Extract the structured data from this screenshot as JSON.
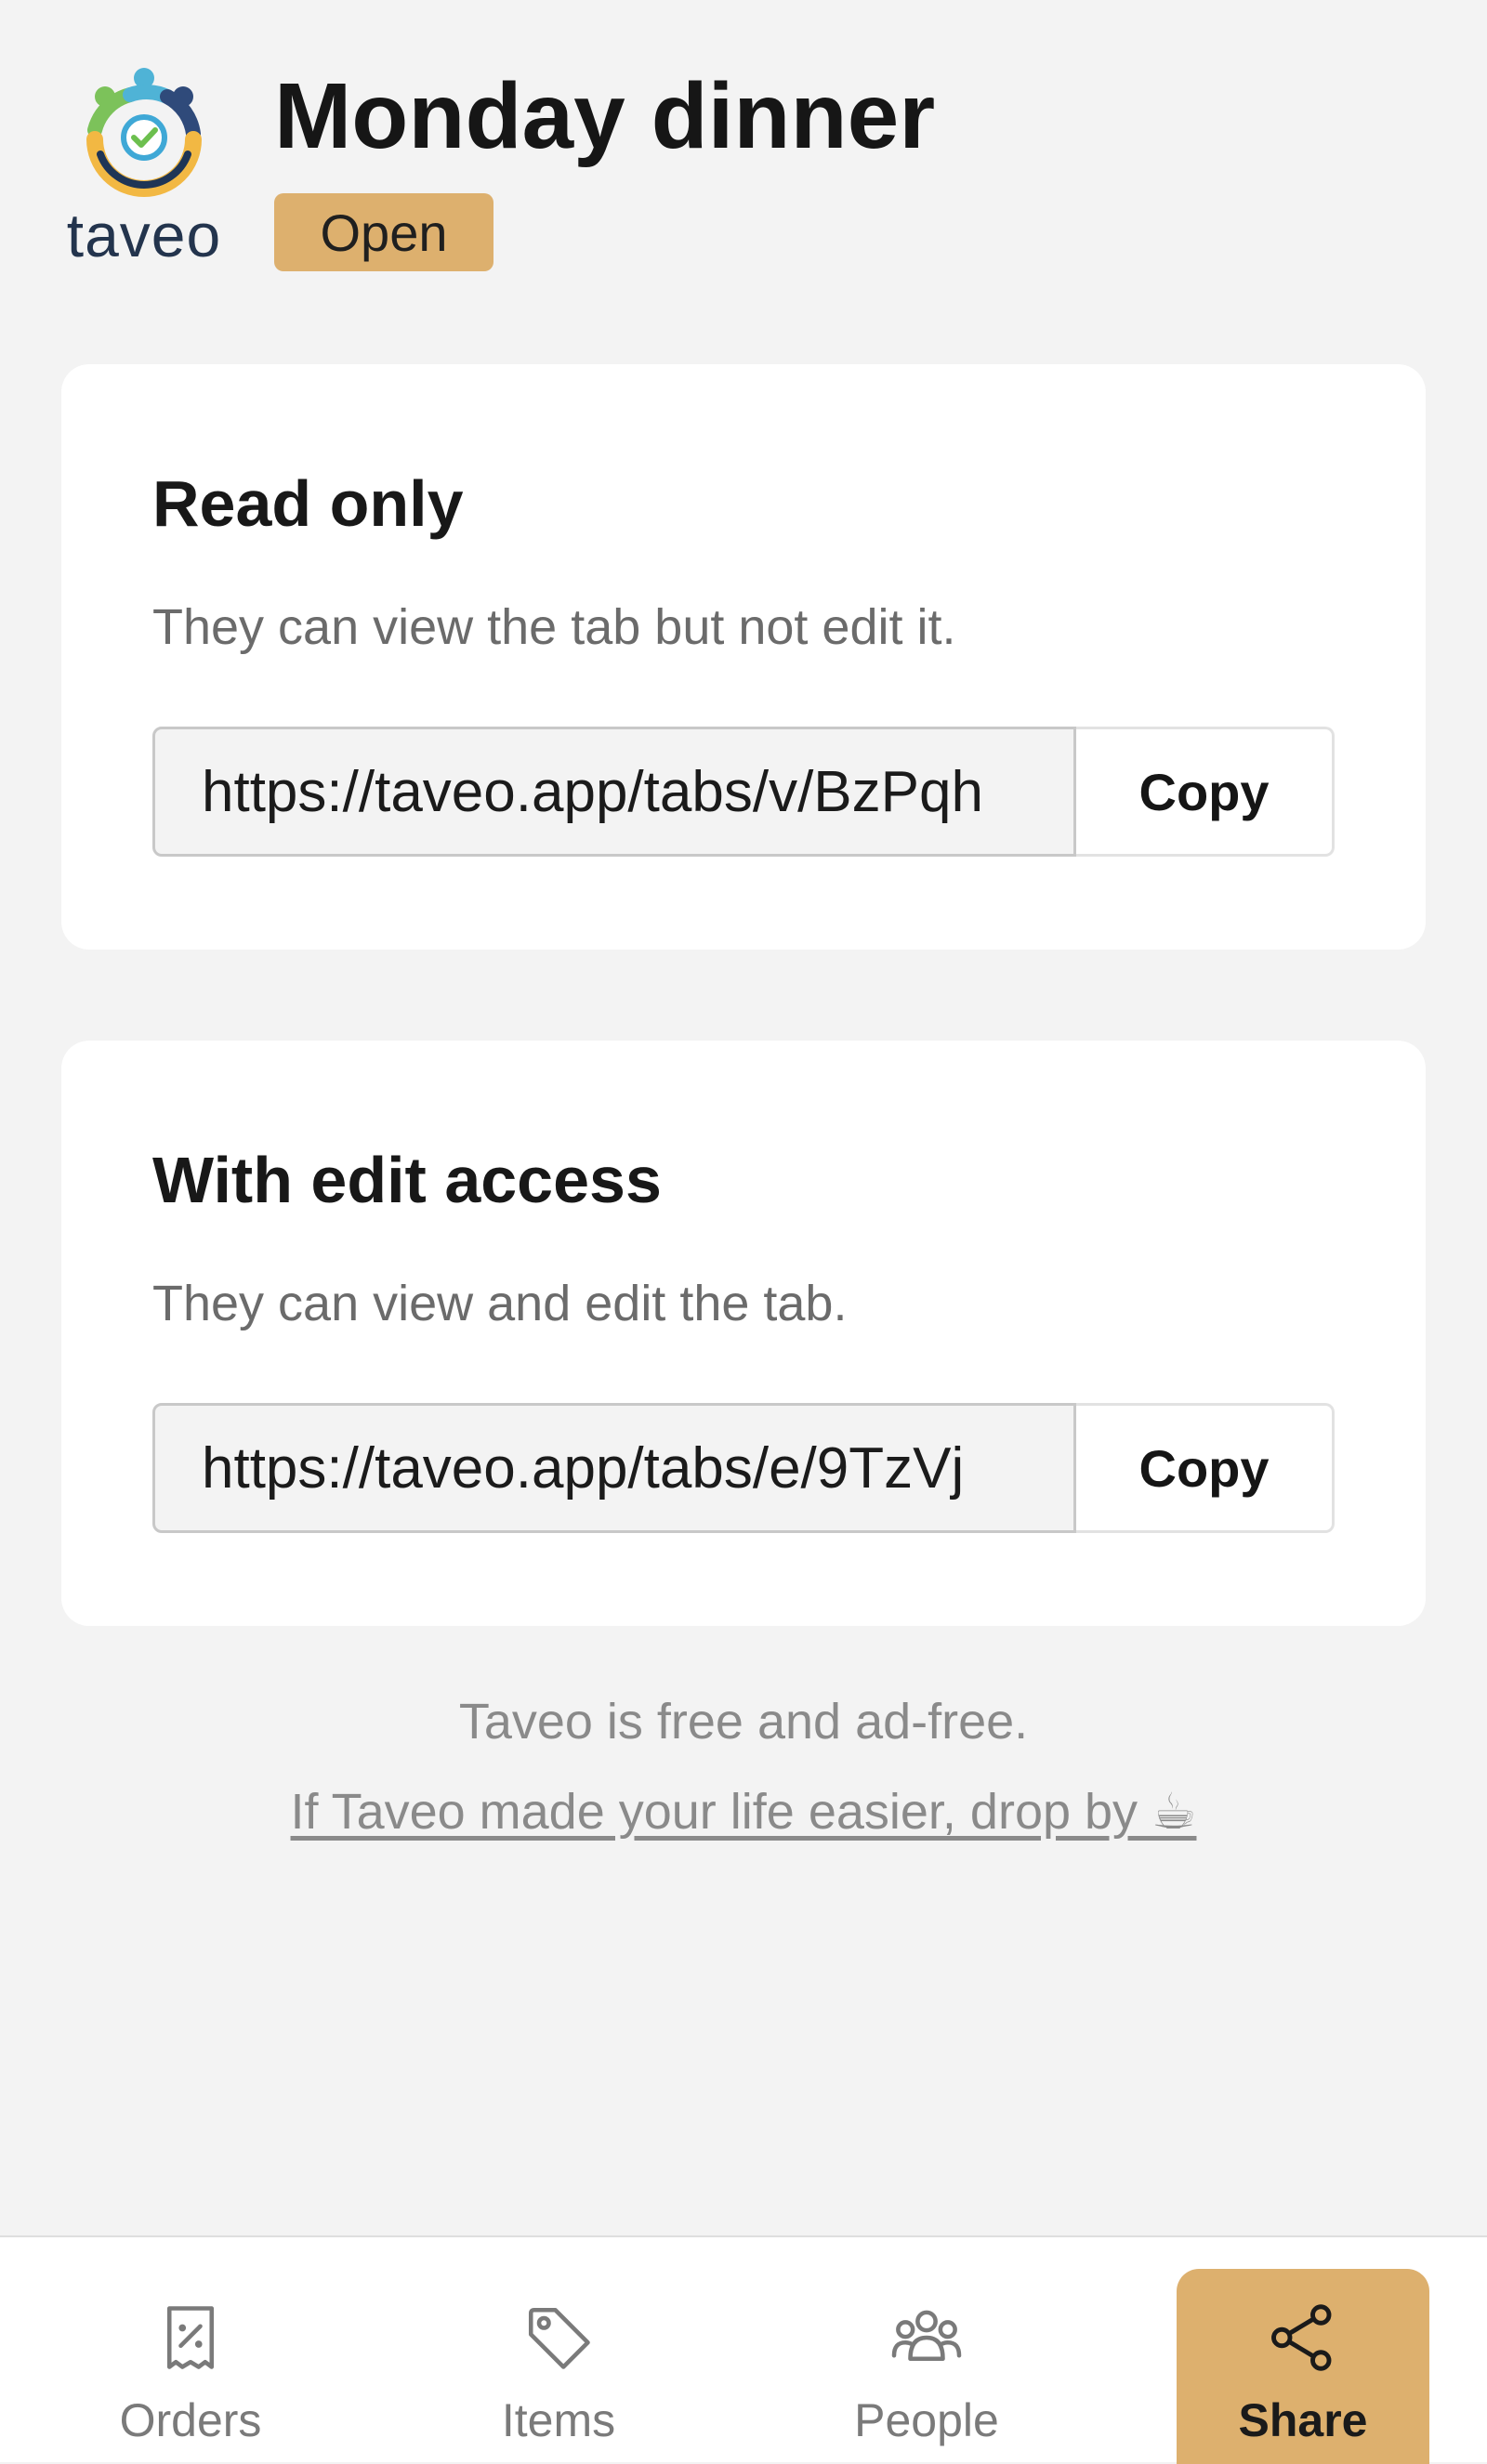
{
  "header": {
    "logo_text": "taveo",
    "title": "Monday dinner",
    "status": "Open"
  },
  "read_only": {
    "title": "Read only",
    "description": "They can view the tab but not edit it.",
    "link": "https://taveo.app/tabs/v/BzPqh",
    "copy_label": "Copy"
  },
  "edit_access": {
    "title": "With edit access",
    "description": "They can view and edit the tab.",
    "link": "https://taveo.app/tabs/e/9TzVj",
    "copy_label": "Copy"
  },
  "footer": {
    "note": "Taveo is free and ad-free.",
    "support_link": "If Taveo made your life easier, drop by ☕"
  },
  "nav": {
    "items": [
      {
        "label": "Orders",
        "icon": "receipt-percent-icon"
      },
      {
        "label": "Items",
        "icon": "tag-icon"
      },
      {
        "label": "People",
        "icon": "people-icon"
      },
      {
        "label": "Share",
        "icon": "share-icon",
        "active": true
      }
    ]
  },
  "colors": {
    "accent": "#ddb06e",
    "background": "#f3f3f3",
    "card": "#ffffff"
  }
}
